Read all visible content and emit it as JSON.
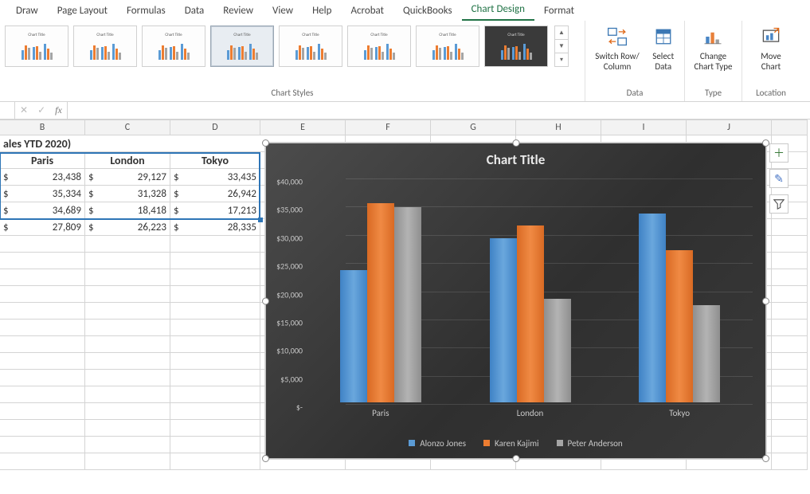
{
  "ribbon": {
    "tabs": [
      "Draw",
      "Page Layout",
      "Formulas",
      "Data",
      "Review",
      "View",
      "Help",
      "Acrobat",
      "QuickBooks",
      "Chart Design",
      "Format"
    ],
    "active_tab": "Chart Design",
    "groups": {
      "chart_styles": "Chart Styles",
      "data": "Data",
      "type": "Type",
      "location": "Location"
    },
    "buttons": {
      "switch": "Switch Row/\nColumn",
      "select_data": "Select\nData",
      "change_type": "Change\nChart Type",
      "move_chart": "Move\nChart"
    },
    "style_thumbs_title": "Chart Title"
  },
  "fx_label": "fx",
  "sheet": {
    "col_labels": [
      "B",
      "C",
      "D",
      "E",
      "F",
      "G",
      "H",
      "I",
      "J"
    ],
    "title_row": "ales YTD 2020)",
    "headers": [
      "Paris",
      "London",
      "Tokyo"
    ],
    "rows": [
      [
        "23,438",
        "29,127",
        "33,435"
      ],
      [
        "35,334",
        "31,328",
        "26,942"
      ],
      [
        "34,689",
        "18,418",
        "17,213"
      ],
      [
        "27,809",
        "26,223",
        "28,335"
      ]
    ],
    "currency_symbol": "$"
  },
  "chart_data": {
    "type": "bar",
    "title": "Chart Title",
    "categories": [
      "Paris",
      "London",
      "Tokyo"
    ],
    "series": [
      {
        "name": "Alonzo Jones",
        "values": [
          23438,
          29127,
          33435
        ],
        "color": "#5b9bd5"
      },
      {
        "name": "Karen Kajimi",
        "values": [
          35334,
          31328,
          26942
        ],
        "color": "#ed7d31"
      },
      {
        "name": "Peter Anderson",
        "values": [
          34689,
          18418,
          17213
        ],
        "color": "#a5a5a5"
      }
    ],
    "ylim": [
      0,
      40000
    ],
    "y_ticks": [
      "$-",
      "$5,000",
      "$10,000",
      "$15,000",
      "$20,000",
      "$25,000",
      "$30,000",
      "$35,000",
      "$40,000"
    ],
    "xlabel": "",
    "ylabel": ""
  }
}
